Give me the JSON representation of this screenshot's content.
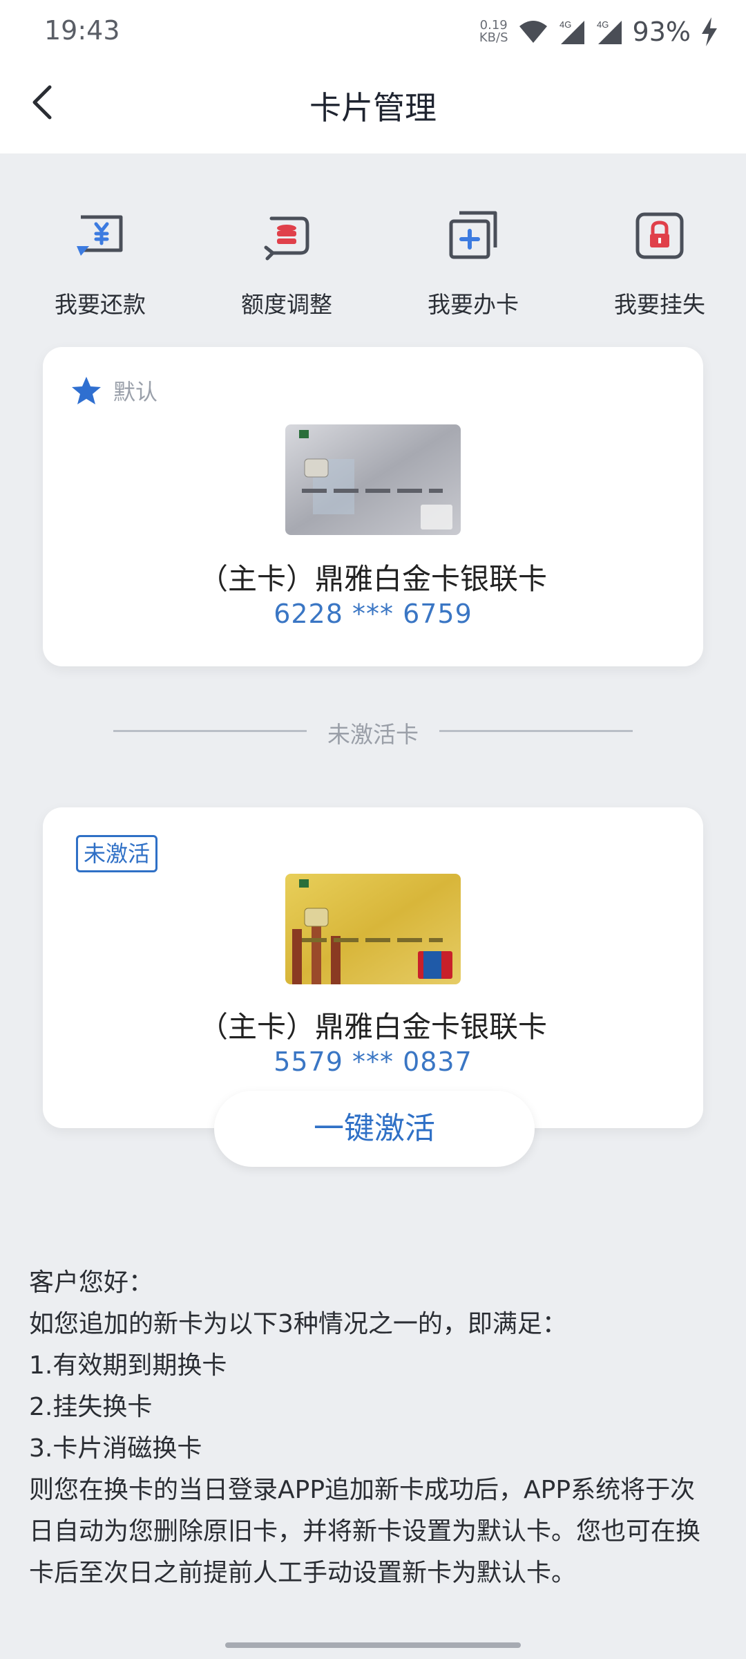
{
  "status": {
    "time": "19:43",
    "net_speed_value": "0.19",
    "net_speed_unit": "KB/S",
    "network_1": "4G",
    "network_2": "4G",
    "battery": "93%"
  },
  "header": {
    "title": "卡片管理"
  },
  "actions": [
    {
      "label": "我要还款",
      "icon": "repay-icon"
    },
    {
      "label": "额度调整",
      "icon": "limit-adjust-icon"
    },
    {
      "label": "我要办卡",
      "icon": "apply-card-icon"
    },
    {
      "label": "我要挂失",
      "icon": "report-loss-icon"
    }
  ],
  "default_card": {
    "tag": "默认",
    "name": "（主卡）鼎雅白金卡银联卡",
    "number": "6228 *** 6759"
  },
  "divider_label": "未激活卡",
  "inactive_card": {
    "tag": "未激活",
    "name": "（主卡）鼎雅白金卡银联卡",
    "number": "5579 *** 0837"
  },
  "activate_button": "一键激活",
  "notice": {
    "greeting": "客户您好：",
    "intro": "如您追加的新卡为以下3种情况之一的，即满足：",
    "items": [
      "1.有效期到期换卡",
      "2.挂失换卡",
      "3.卡片消磁换卡"
    ],
    "body": "则您在换卡的当日登录APP追加新卡成功后，APP系统将于次日自动为您删除原旧卡，并将新卡设置为默认卡。您也可在换卡后至次日之前提前人工手动设置新卡为默认卡。"
  },
  "colors": {
    "accent": "#2f70c6",
    "icon_blue": "#3c7be0",
    "icon_red": "#e0404a",
    "icon_gray": "#4a4f59"
  }
}
